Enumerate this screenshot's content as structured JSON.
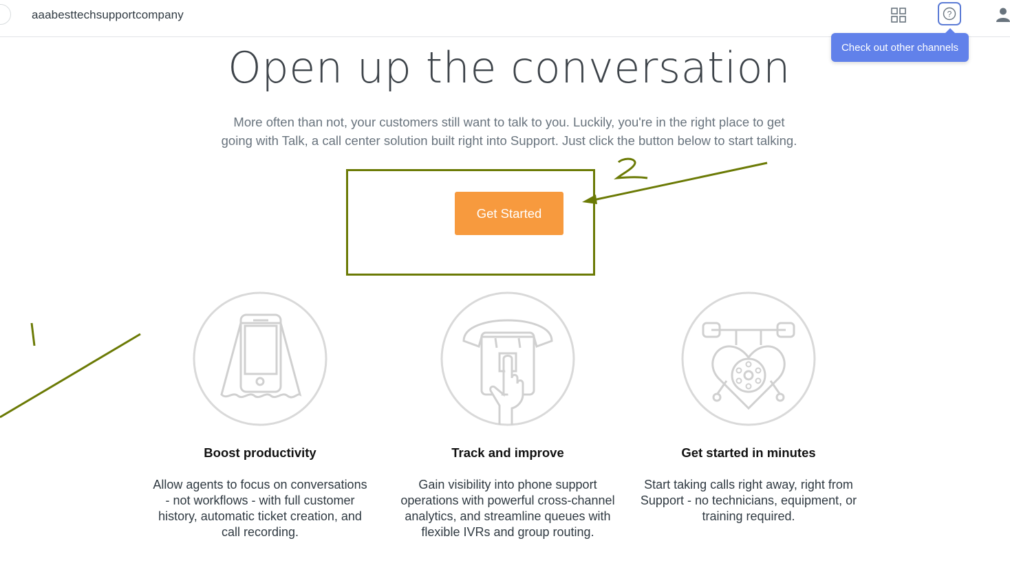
{
  "header": {
    "brand": "aaabesttechsupportcompany",
    "tooltip": "Check out other channels"
  },
  "hero": {
    "title": "Open up the conversation",
    "intro_line1": "More often than not, your customers still want to talk to you. Luckily, you're in the right place to get",
    "intro_line2": "going with Talk, a call center solution built right into Support. Just click the button below to start talking.",
    "cta_label": "Get Started"
  },
  "annotations": {
    "mark_1": "1",
    "mark_2": "2",
    "color": "#6b7a05"
  },
  "features": [
    {
      "icon": "smartphone-icon",
      "title": "Boost productivity",
      "desc_lines": [
        "Allow agents to focus on conversations",
        "- not workflows - with full customer",
        "history, automatic ticket creation, and",
        "call recording."
      ]
    },
    {
      "icon": "phone-dial-icon",
      "title": "Track and improve",
      "desc_lines": [
        "Gain visibility into phone support",
        "operations with powerful cross-channel",
        "analytics, and streamline queues with",
        "flexible IVRs and group routing."
      ]
    },
    {
      "icon": "heart-telephone-icon",
      "title": "Get started in minutes",
      "desc_lines": [
        "Start taking calls right away, right from",
        "Support - no technicians, equipment, or",
        "training required."
      ]
    }
  ],
  "colors": {
    "cta": "#f79a3e",
    "tooltip": "#6181ea",
    "help_border": "#5b7bd5"
  }
}
